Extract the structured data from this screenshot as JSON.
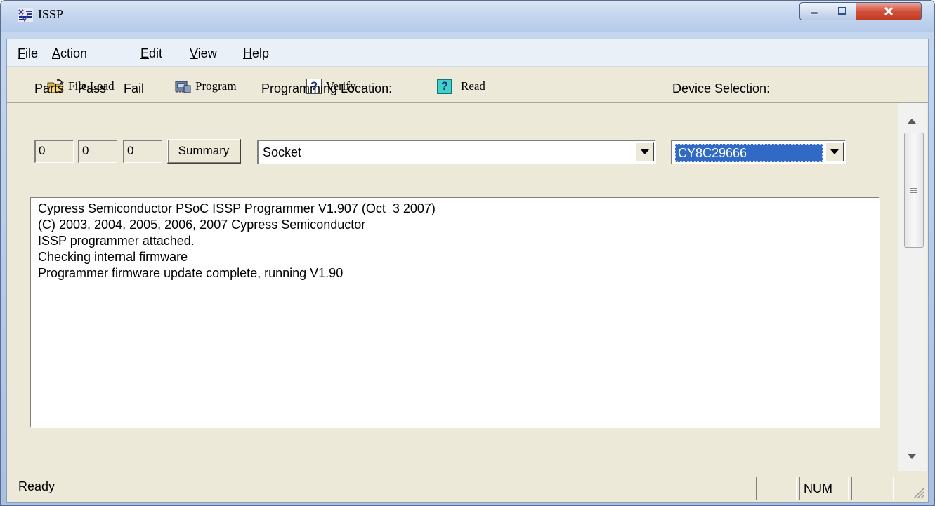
{
  "window": {
    "title": "ISSP"
  },
  "menu": {
    "file": "File",
    "action": "Action",
    "edit": "Edit",
    "view": "View",
    "help": "Help"
  },
  "toolbar": {
    "file_load": "File Load",
    "program": "Program",
    "verify": "Verify",
    "read": "Read"
  },
  "counters": {
    "parts_label": "Parts",
    "pass_label": "Pass",
    "fail_label": "Fail",
    "parts_value": "0",
    "pass_value": "0",
    "fail_value": "0",
    "summary_label": "Summary"
  },
  "programming_location": {
    "label": "Programming Location:",
    "value": "Socket"
  },
  "device_selection": {
    "label": "Device Selection:",
    "value": "CY8C29666"
  },
  "log": [
    "Cypress Semiconductor PSoC ISSP Programmer V1.907 (Oct  3 2007)",
    "(C) 2003, 2004, 2005, 2006, 2007 Cypress Semiconductor",
    "ISSP programmer attached.",
    "Checking internal firmware",
    "Programmer firmware update complete, running V1.90"
  ],
  "status": {
    "text": "Ready",
    "num": "NUM"
  },
  "icons": {
    "app": "issp-app-icon",
    "file_load": "folder-open-icon",
    "program": "programmer-device-icon",
    "verify": "question-icon",
    "read": "question-teal-icon"
  },
  "colors": {
    "selection": "#316ac5",
    "close_button": "#c23b23",
    "dialog_face": "#ece9d8"
  }
}
